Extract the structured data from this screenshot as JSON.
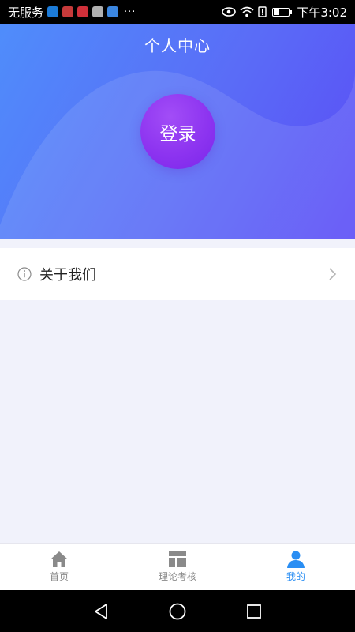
{
  "status_bar": {
    "carrier": "无服务",
    "time": "下午3:02",
    "more": "···",
    "apps": [
      {
        "icon": "video-app-icon",
        "color": "#1c7bd8"
      },
      {
        "icon": "doc-app-icon",
        "color": "#c63a3a"
      },
      {
        "icon": "huawei-app-icon",
        "color": "#d0303a"
      },
      {
        "icon": "gallery-app-icon",
        "color": "#b0b0b0"
      },
      {
        "icon": "music-app-icon",
        "color": "#3b86e0"
      }
    ]
  },
  "header": {
    "title": "个人中心",
    "login_label": "登录",
    "gradient_start": "#4f8dfb",
    "gradient_end": "#5b4cf6",
    "login_color": "#8d34f0"
  },
  "menu": {
    "items": [
      {
        "label": "关于我们",
        "icon": "info-icon"
      }
    ]
  },
  "tabbar": {
    "active_color": "#2a8ef3",
    "tabs": [
      {
        "label": "首页",
        "icon": "home-icon",
        "active": false
      },
      {
        "label": "理论考核",
        "icon": "layout-icon",
        "active": false
      },
      {
        "label": "我的",
        "icon": "user-icon",
        "active": true
      }
    ]
  }
}
